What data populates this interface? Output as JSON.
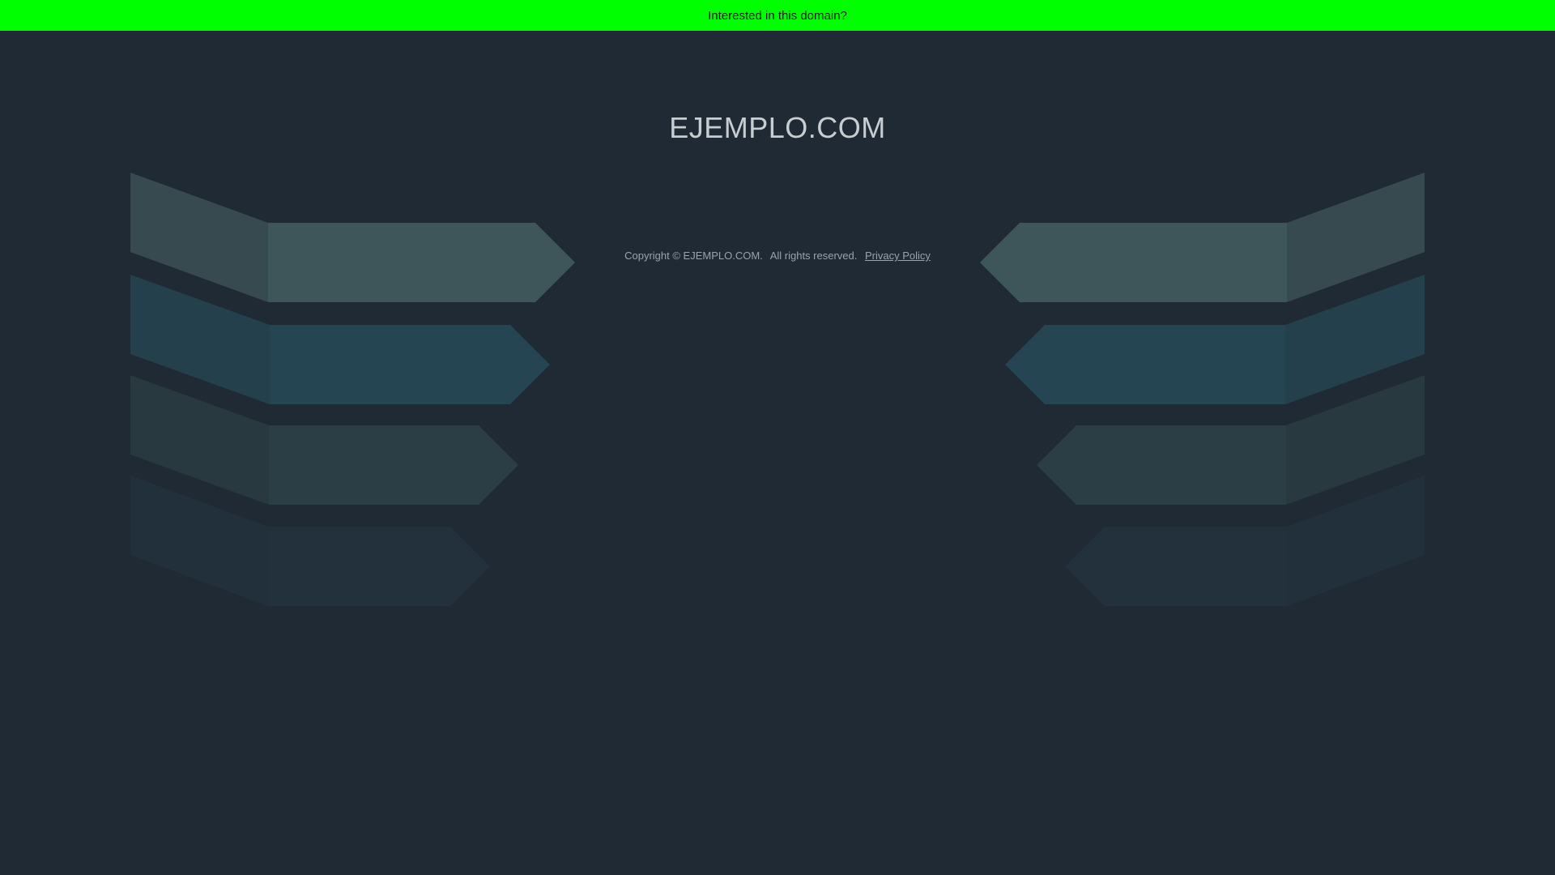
{
  "banner": {
    "text": "Interested in this domain?",
    "color": "#00ff00"
  },
  "domain": {
    "title": "EJEMPLO.COM"
  },
  "footer": {
    "copyright_prefix": "Copyright ©",
    "copyright_domain": "EJEMPLO.COM.",
    "rights": "All rights reserved.",
    "privacy_link": "Privacy Policy"
  },
  "colors": {
    "background": "#1f2a34",
    "band1_wing": "#374a4f",
    "band1_arrow": "#3e5559",
    "band2_wing": "#24404d",
    "band2_arrow": "#264553",
    "band3_wing": "#293940",
    "band3_arrow": "#2c3e45",
    "band4_wing": "#21303b",
    "band4_arrow": "#22313c"
  }
}
